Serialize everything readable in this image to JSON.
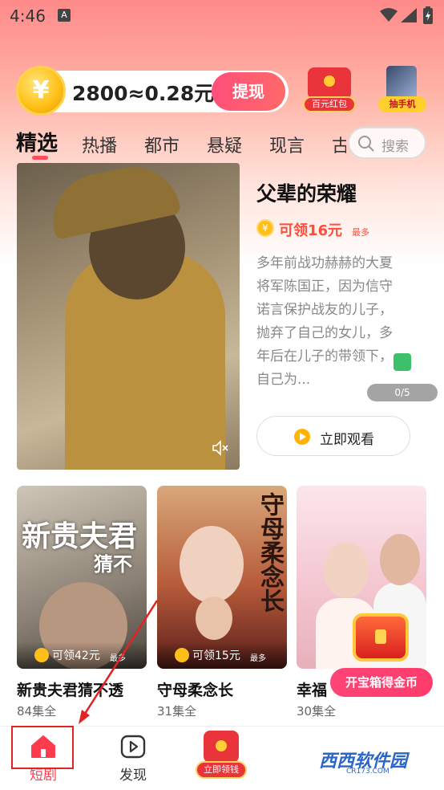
{
  "status_bar": {
    "time": "4:46",
    "notification_badge": "A"
  },
  "coin_bar": {
    "coin_symbol": "¥",
    "balance": "2800≈0.28元",
    "withdraw_label": "提现"
  },
  "promos": [
    {
      "label": "百元红包",
      "icon": "red-envelope-icon"
    },
    {
      "label": "抽手机",
      "icon": "phone-prize-icon"
    }
  ],
  "tabs": [
    "精选",
    "热播",
    "都市",
    "悬疑",
    "现言",
    "古"
  ],
  "active_tab": "精选",
  "search": {
    "placeholder": "搜索"
  },
  "featured": {
    "title": "父辈的荣耀",
    "reward": "可领16元",
    "reward_suffix": "最多",
    "description": "多年前战功赫赫的大夏将军陈国正，因为信守诺言保护战友的儿子，抛弃了自己的女儿，多年后在儿子的带领下，自己为...",
    "counter": "0/5",
    "watch_label": "立即观看"
  },
  "cards": [
    {
      "poster_title_big": "新贵夫君",
      "poster_title_small": "猜不",
      "reward": "可领42元",
      "reward_suffix": "最多",
      "title": "新贵夫君猜不透",
      "episodes": "84集全"
    },
    {
      "poster_title": "守母柔念长",
      "reward": "可领15元",
      "reward_suffix": "最多",
      "title": "守母柔念长",
      "episodes": "31集全"
    },
    {
      "title": "幸福",
      "episodes": "30集全"
    }
  ],
  "treasure": {
    "label": "开宝箱得金币"
  },
  "bottom_nav": {
    "items": [
      {
        "label": "短剧",
        "icon": "home-icon",
        "active": true
      },
      {
        "label": "发现",
        "icon": "play-icon",
        "active": false
      },
      {
        "label": "立即领钱",
        "icon": "red-envelope-icon",
        "active": false
      }
    ]
  },
  "watermark": {
    "text": "西西软件园",
    "sub": "CR173.COM"
  },
  "colors": {
    "accent": "#ff3b4e",
    "reward": "#ff4d3a",
    "coin": "#ffbf1a"
  }
}
